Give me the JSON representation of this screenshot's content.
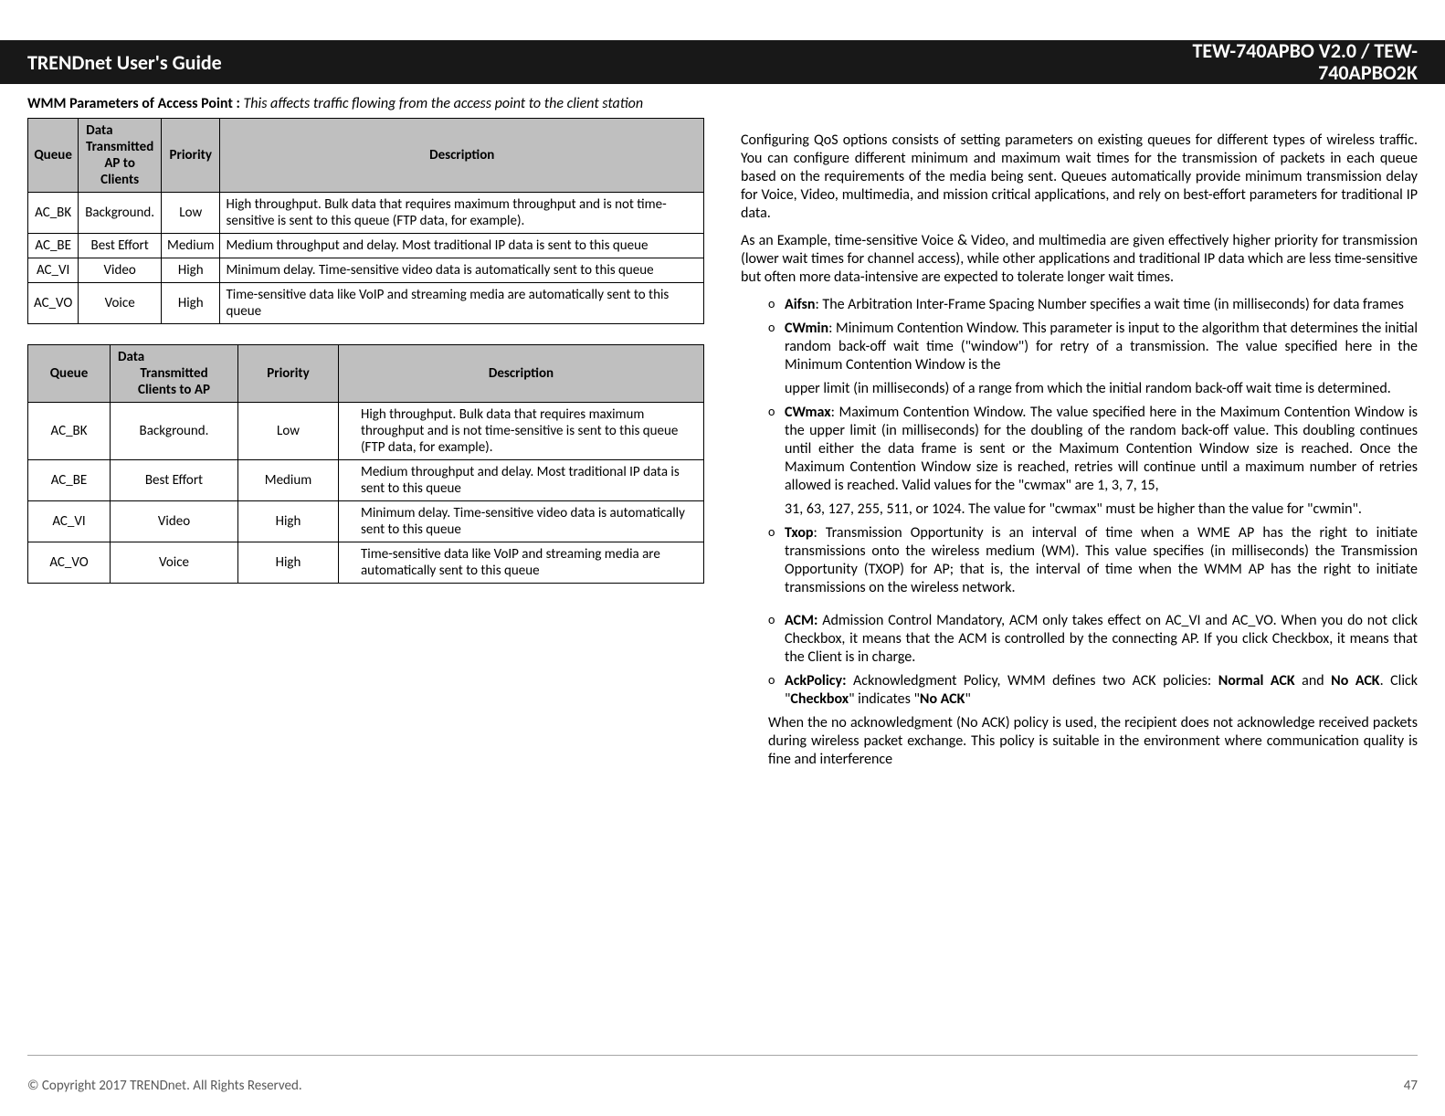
{
  "header": {
    "left": "TRENDnet User's Guide",
    "right": "TEW-740APBO V2.0 / TEW-\n740APBO2K"
  },
  "intro": {
    "lead": "WMM Parameters of Access Point :",
    "text": " This affects traffic flowing from the access point to the client station"
  },
  "table1": {
    "headers": {
      "queue": "Queue",
      "data_line1": "Data",
      "data_line2": "Transmitted",
      "data_line3": "AP to Clients",
      "priority": "Priority",
      "description": "Description"
    },
    "rows": [
      {
        "queue": "AC_BK",
        "data": "Background.",
        "priority": "Low",
        "desc": "High throughput. Bulk data that requires maximum throughput and is not time-sensitive is sent to this queue (FTP data, for example)."
      },
      {
        "queue": "AC_BE",
        "data": "Best Effort",
        "priority": "Medium",
        "desc": "Medium throughput and delay. Most traditional IP data is sent to this queue"
      },
      {
        "queue": "AC_VI",
        "data": "Video",
        "priority": "High",
        "desc": "Minimum delay. Time-sensitive video data is automatically sent to this queue"
      },
      {
        "queue": "AC_VO",
        "data": "Voice",
        "priority": "High",
        "desc": "Time-sensitive data like VoIP and streaming media are automatically sent to this queue"
      }
    ]
  },
  "table2": {
    "headers": {
      "queue": "Queue",
      "data_line1": "Data",
      "data_line2": "Transmitted",
      "data_line3": "Clients to AP",
      "priority": "Priority",
      "description": "Description"
    },
    "rows": [
      {
        "queue": "AC_BK",
        "data": "Background.",
        "priority": "Low",
        "desc": "High throughput. Bulk data that requires maximum throughput and is not time-sensitive is sent to this queue (FTP data, for example)."
      },
      {
        "queue": "AC_BE",
        "data": "Best Effort",
        "priority": "Medium",
        "desc": "Medium throughput and delay. Most traditional IP data is sent to this queue"
      },
      {
        "queue": "AC_VI",
        "data": "Video",
        "priority": "High",
        "desc": "Minimum delay. Time-sensitive video data is automatically sent to this queue"
      },
      {
        "queue": "AC_VO",
        "data": "Voice",
        "priority": "High",
        "desc": "Time-sensitive data like VoIP and streaming media are automatically sent to this queue"
      }
    ]
  },
  "right": {
    "para1": "Configuring QoS options consists of setting parameters on existing queues for different types of wireless traffic. You can configure different minimum and maximum wait times for the transmission of packets in each queue based on the requirements of the media being sent. Queues automatically provide minimum transmission delay for Voice, Video, multimedia, and mission critical applications, and rely on best-effort parameters for traditional IP data.",
    "para2": "As an Example, time-sensitive Voice & Video, and multimedia are given effectively higher priority for transmission (lower wait times for channel access), while other applications and traditional IP data which are less time-sensitive but often more data-intensive are expected to tolerate longer wait times.",
    "bullets": {
      "aifsn": {
        "term": "Aifsn",
        "text": ": The Arbitration Inter-Frame Spacing Number specifies a wait time (in milliseconds) for data frames"
      },
      "cwmin": {
        "term": "CWmin",
        "text": ": Minimum Contention Window. This parameter is input to the algorithm that determines the initial random back-off wait time (\"window\") for retry of a transmission. The value specified here in the Minimum Contention Window is the",
        "extra": "upper limit (in milliseconds) of a range from which the initial random back-off wait time is determined."
      },
      "cwmax": {
        "term": "CWmax",
        "text": ": Maximum Contention Window. The value specified here in the Maximum Contention Window is the upper limit (in milliseconds) for the doubling of the random back-off value. This doubling continues until either the data frame is sent or the Maximum Contention Window size is reached. Once the Maximum Contention Window size is reached, retries will continue until a maximum number of retries allowed is reached. Valid values for the \"cwmax\" are 1, 3, 7, 15,",
        "extra": "31, 63, 127, 255, 511, or 1024. The value for \"cwmax\" must be higher than the value for \"cwmin\"."
      },
      "txop": {
        "term": "Txop",
        "text": ": Transmission Opportunity is an interval of time when a WME AP has the   right to initiate transmissions onto the wireless medium (WM). This value specifies (in milliseconds) the Transmission Opportunity (TXOP) for AP; that is, the interval of time when the WMM AP has the right to initiate transmissions on the wireless network."
      },
      "acm": {
        "term": "ACM:",
        "text": " Admission Control Mandatory, ACM only takes effect on AC_VI and AC_VO. When you do not click Checkbox, it means that the ACM is controlled by the connecting AP. If you click Checkbox, it means that the Client is in charge."
      },
      "ack": {
        "term": "AckPolicy:",
        "text_before": " Acknowledgment Policy, WMM defines two ACK policies: ",
        "term2": "Normal ACK",
        "text_mid": " and ",
        "term3": "No ACK",
        "text_after": ". Click \"",
        "term4": "Checkbox",
        "text_after2": "\" indicates \"",
        "term5": "No ACK",
        "text_end": "\""
      }
    },
    "trailing": "When the no acknowledgment (No ACK) policy is used, the recipient does not acknowledge received packets during wireless packet exchange. This policy is suitable in the environment where communication quality is fine and interference"
  },
  "footer": {
    "copyright": "© Copyright 2017 TRENDnet. All Rights Reserved.",
    "page": "47"
  }
}
